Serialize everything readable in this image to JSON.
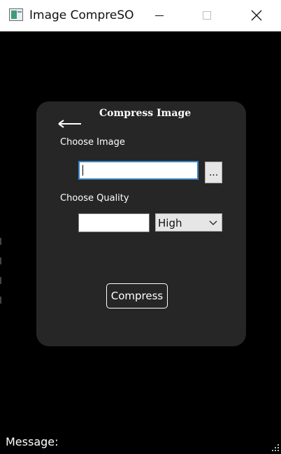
{
  "window": {
    "title": "Image CompreSO",
    "icons": {
      "app": "app-icon",
      "minimize": "minimize-icon",
      "maximize": "maximize-icon",
      "close": "close-icon"
    }
  },
  "card": {
    "back_icon": "back-arrow-icon",
    "title": "Compress Image",
    "choose_image_label": "Choose Image",
    "image_path_value": "",
    "browse_label": "...",
    "choose_quality_label": "Choose Quality",
    "quality_value": "",
    "quality_selected": "High",
    "compress_label": "Compress"
  },
  "status": {
    "message_label": "Message:",
    "message_value": ""
  },
  "colors": {
    "background": "#000000",
    "card": "#262626",
    "focus_border": "#3b83c4",
    "text": "#ffffff"
  }
}
